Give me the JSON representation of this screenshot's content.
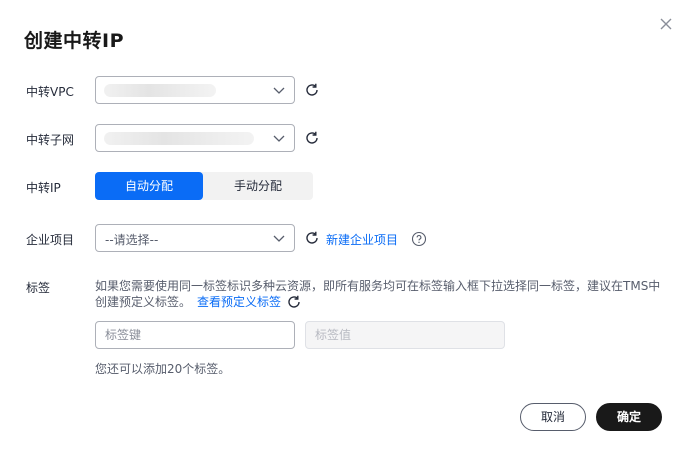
{
  "dialog": {
    "title": "创建中转IP",
    "close_icon": "close-icon"
  },
  "form": {
    "vpc": {
      "label": "中转VPC",
      "value": ""
    },
    "subnet": {
      "label": "中转子网",
      "value": ""
    },
    "ip": {
      "label": "中转IP",
      "options": [
        "自动分配",
        "手动分配"
      ],
      "selected": "自动分配"
    },
    "enterprise_project": {
      "label": "企业项目",
      "placeholder": "--请选择--",
      "create_link": "新建企业项目"
    },
    "tags": {
      "label": "标签",
      "desc_line1": "如果您需要使用同一标签标识多种云资源，即所有服务均可在标签输入框下拉选择同一标签，建议在TMS中",
      "desc_line2": "创建预定义标签。",
      "view_link": "查看预定义标签",
      "key_placeholder": "标签键",
      "value_placeholder": "标签值",
      "remaining": "您还可以添加20个标签。"
    }
  },
  "footer": {
    "cancel": "取消",
    "confirm": "确定"
  },
  "colors": {
    "primary": "#0a6cf6",
    "confirm_bg": "#191919",
    "border": "#adb0b8"
  }
}
